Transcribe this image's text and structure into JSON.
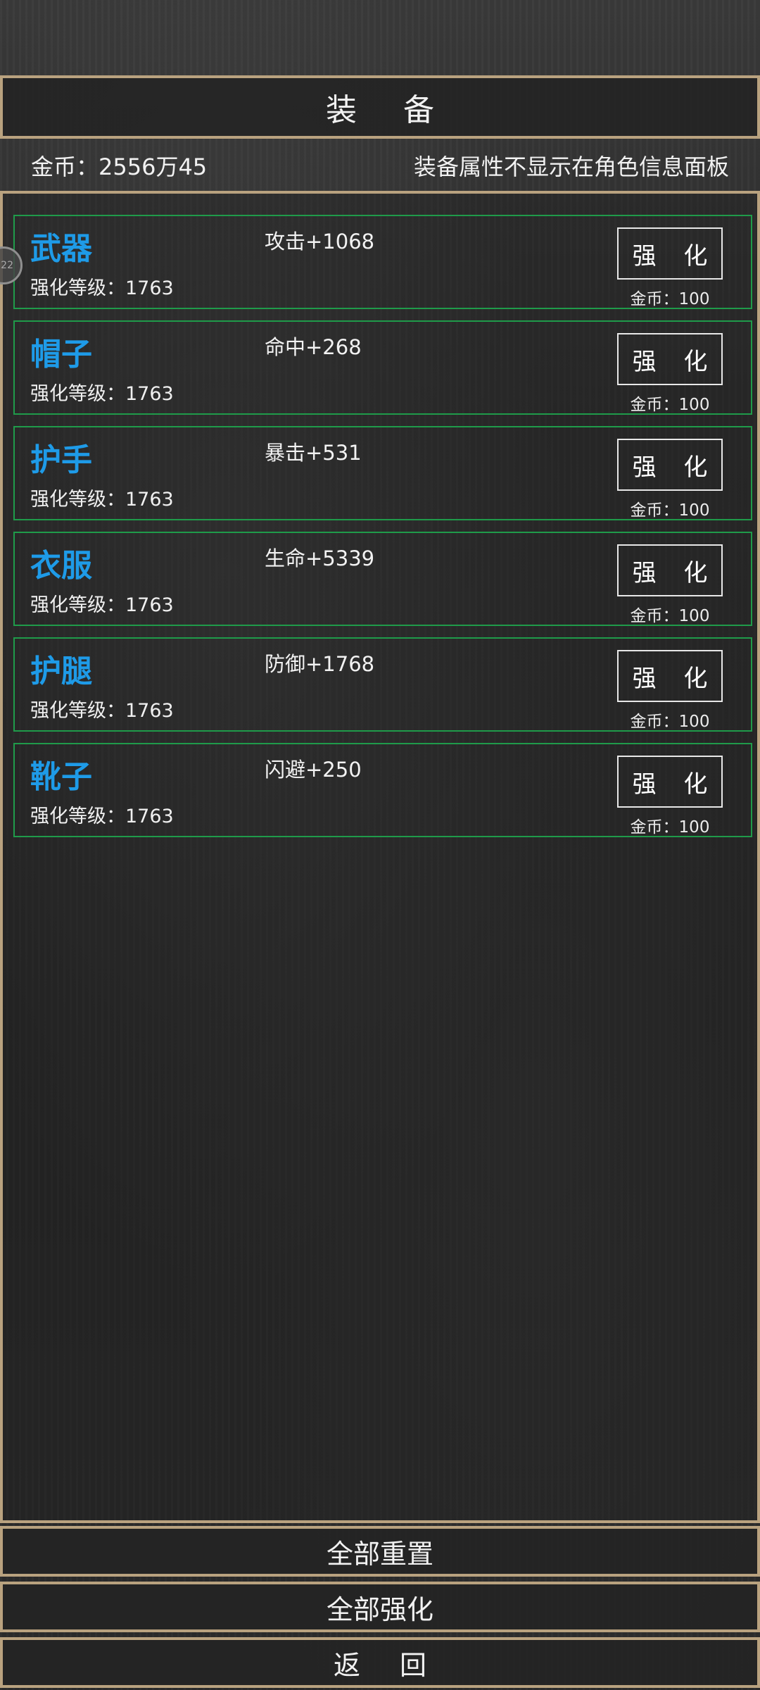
{
  "header": {
    "title": "装 备"
  },
  "info": {
    "gold_text": "金币：2556万45",
    "notice": "装备属性不显示在角色信息面板"
  },
  "floating_ball": {
    "text": "22"
  },
  "equipment": [
    {
      "name": "武器",
      "level": "强化等级：1763",
      "stat": "攻击+1068",
      "button": "强 化",
      "cost": "金币：100"
    },
    {
      "name": "帽子",
      "level": "强化等级：1763",
      "stat": "命中+268",
      "button": "强 化",
      "cost": "金币：100"
    },
    {
      "name": "护手",
      "level": "强化等级：1763",
      "stat": "暴击+531",
      "button": "强 化",
      "cost": "金币：100"
    },
    {
      "name": "衣服",
      "level": "强化等级：1763",
      "stat": "生命+5339",
      "button": "强 化",
      "cost": "金币：100"
    },
    {
      "name": "护腿",
      "level": "强化等级：1763",
      "stat": "防御+1768",
      "button": "强 化",
      "cost": "金币：100"
    },
    {
      "name": "靴子",
      "level": "强化等级：1763",
      "stat": "闪避+250",
      "button": "强 化",
      "cost": "金币：100"
    }
  ],
  "footer": {
    "reset_all": "全部重置",
    "enhance_all": "全部强化",
    "back": "返 回"
  },
  "colors": {
    "border_gold": "#b9a27f",
    "item_border_green": "#1f9b4a",
    "item_name_blue": "#1e9be8"
  }
}
